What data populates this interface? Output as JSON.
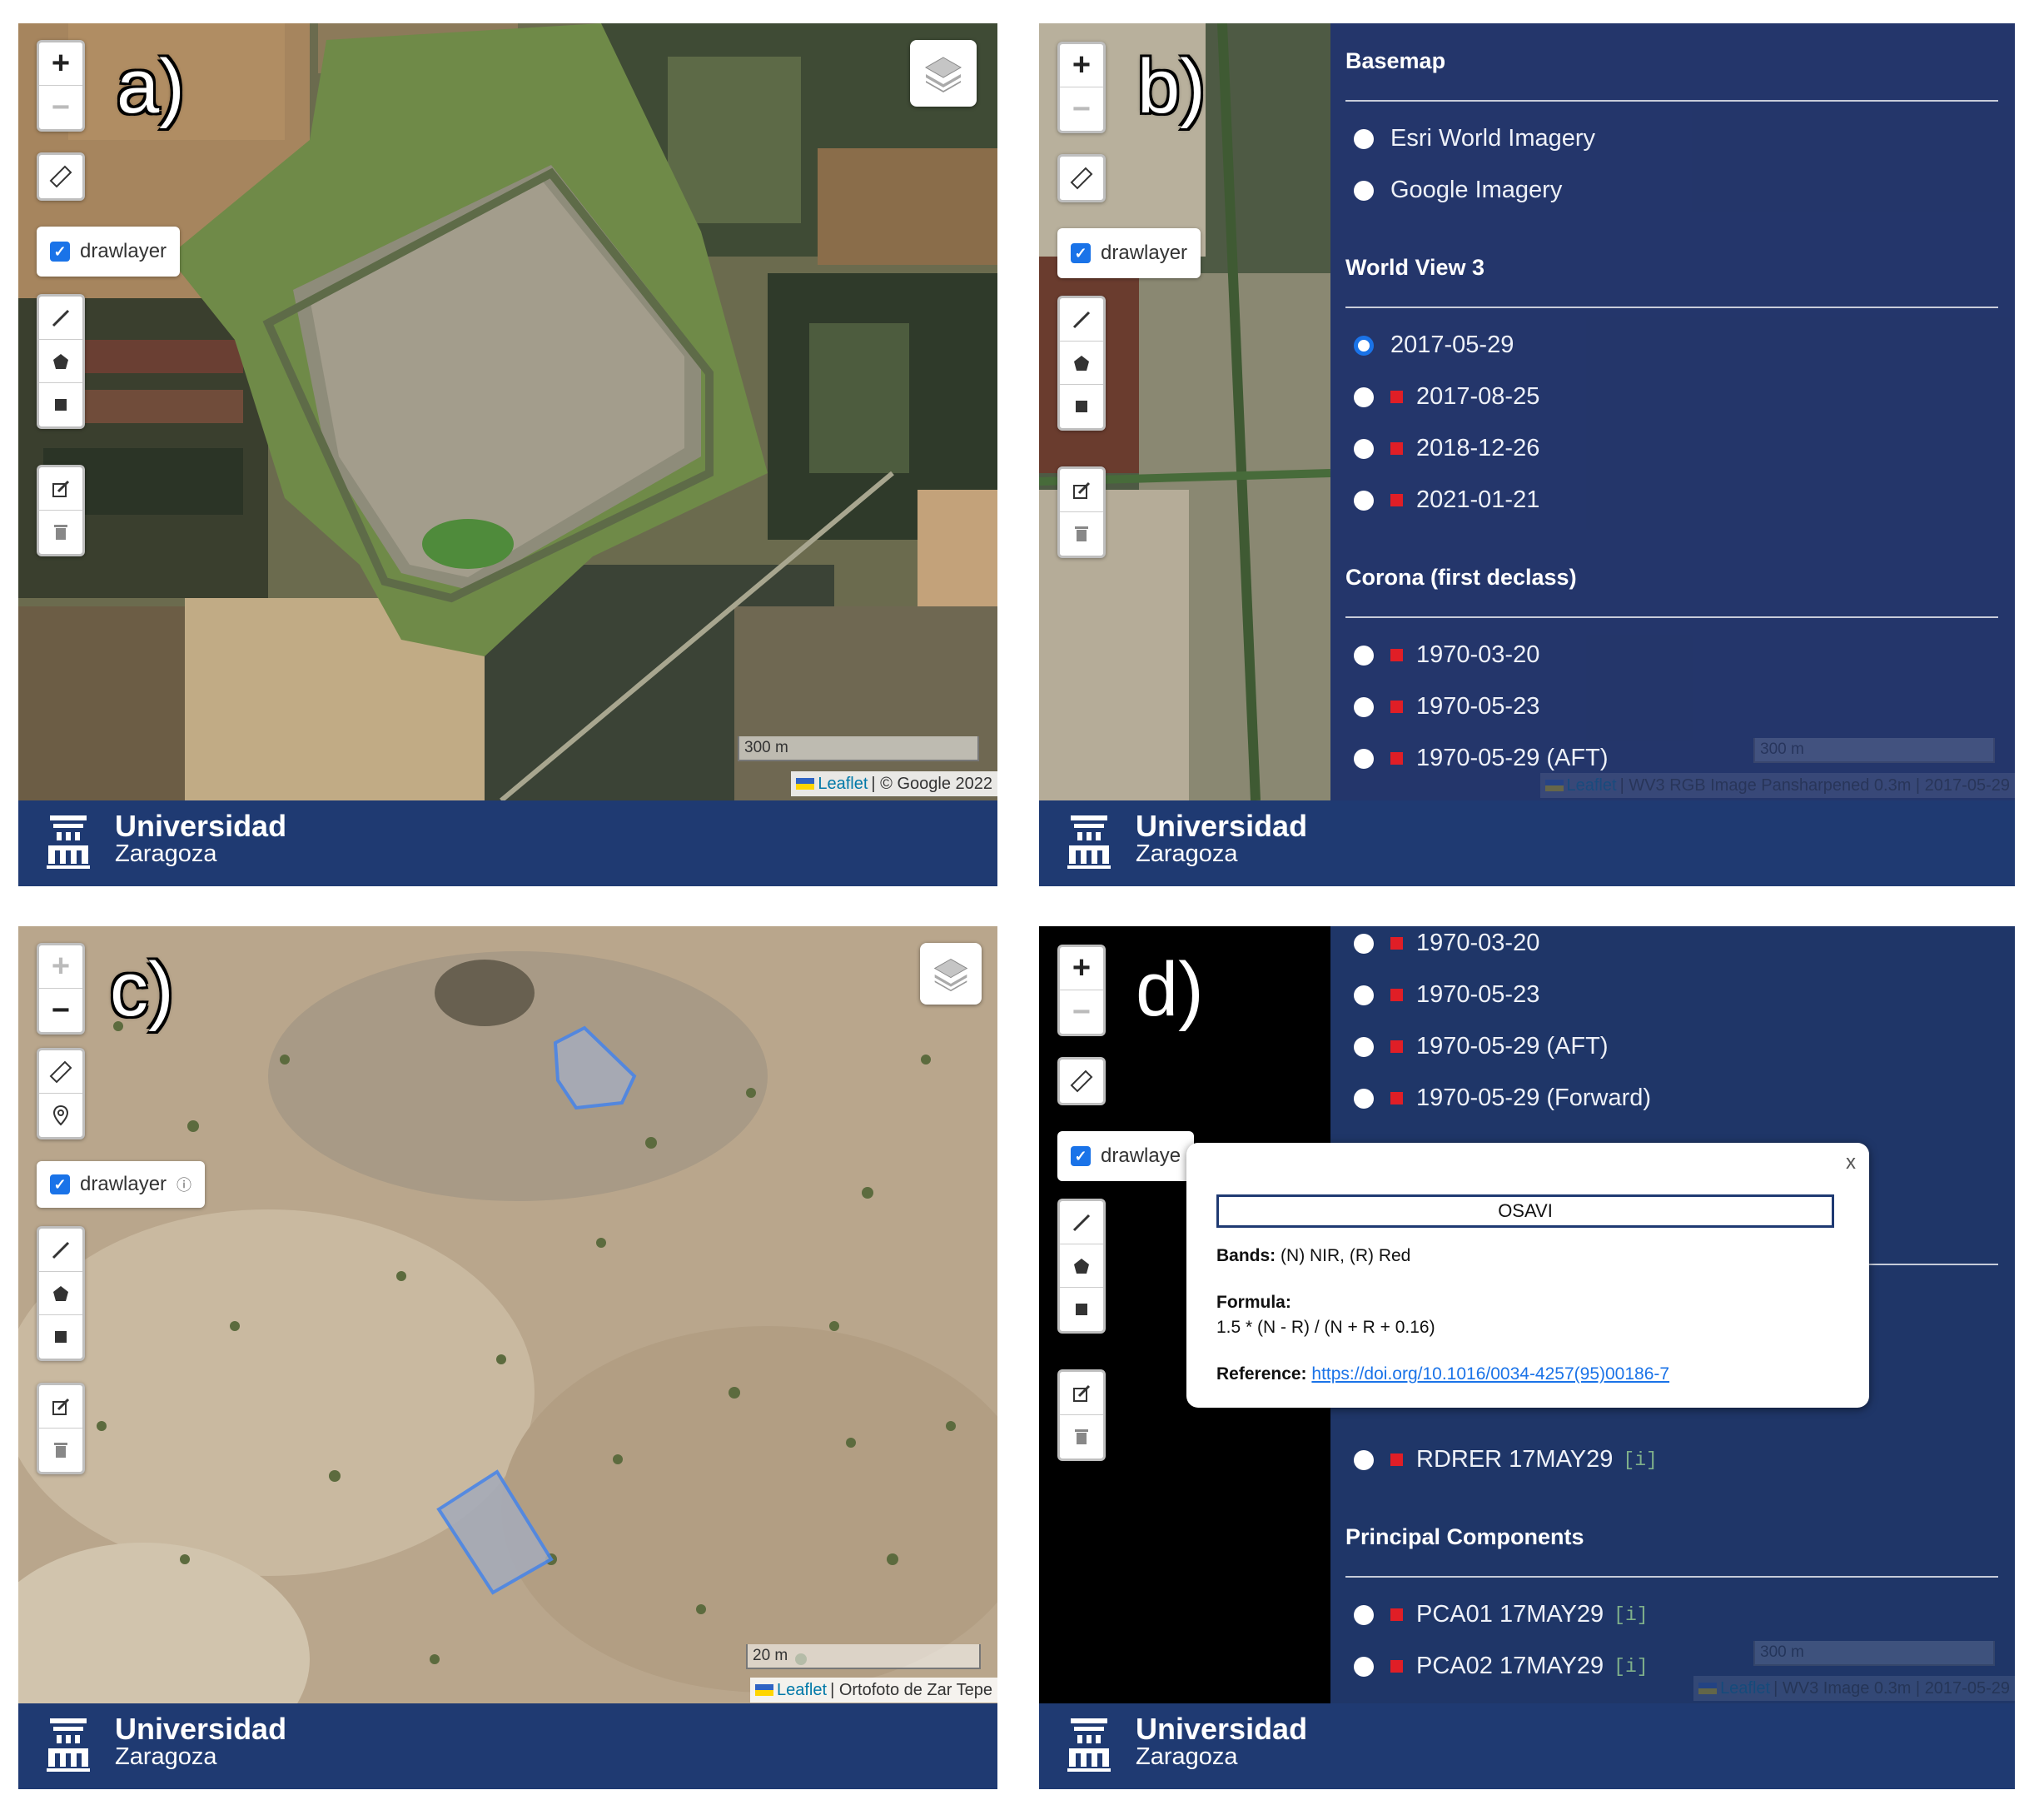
{
  "brand": {
    "name": "Universidad",
    "city": "Zaragoza"
  },
  "panels": [
    {
      "letter": "a)",
      "drawlayer": "drawlayer",
      "scale": "300 m",
      "attribution_leaflet": "Leaflet",
      "attribution_text": "| © Google 2022"
    },
    {
      "letter": "b)",
      "drawlayer": "drawlayer",
      "scale": "300 m",
      "attribution_leaflet": "Leaflet",
      "attribution_text": "| WV3 RGB Image Pansharpened 0.3m | 2017-05-29"
    },
    {
      "letter": "c)",
      "drawlayer": "drawlayer",
      "scale": "20 m",
      "attribution_leaflet": "Leaflet",
      "attribution_text": "| Ortofoto de Zar Tepe"
    },
    {
      "letter": "d)",
      "drawlayer": "drawlaye",
      "scale": "300 m",
      "attribution_leaflet": "Leaflet",
      "attribution_text": "| WV3 Image 0.3m | 2017-05-29"
    }
  ],
  "controls": {
    "zoom_in": "+",
    "zoom_out": "−"
  },
  "layers_b": {
    "basemap": {
      "heading": "Basemap",
      "items": [
        "Esri World Imagery",
        "Google Imagery"
      ]
    },
    "wv3": {
      "heading": "World View 3",
      "items": [
        "2017-05-29",
        "2017-08-25",
        "2018-12-26",
        "2021-01-21"
      ]
    },
    "corona": {
      "heading": "Corona (first declass)",
      "items": [
        "1970-03-20",
        "1970-05-23",
        "1970-05-29 (AFT)"
      ]
    }
  },
  "layers_d": {
    "items_top": [
      "1970-03-20",
      "1970-05-23",
      "1970-05-29 (AFT)",
      "1970-05-29 (Forward)"
    ],
    "rdrer": {
      "label": "RDRER 17MAY29",
      "info": "[i]"
    },
    "pc": {
      "heading": "Principal Components",
      "items": [
        {
          "label": "PCA01 17MAY29",
          "info": "[i]"
        },
        {
          "label": "PCA02 17MAY29",
          "info": "[i]"
        }
      ]
    }
  },
  "popup": {
    "close": "x",
    "title": "OSAVI",
    "bands_label": "Bands:",
    "bands_value": "(N) NIR, (R) Red",
    "formula_label": "Formula:",
    "formula_value": "1.5 * (N - R) / (N + R + 0.16)",
    "reference_label": "Reference:",
    "reference_value": "https://doi.org/10.1016/0034-4257(95)00186-7"
  },
  "colors": {
    "footer": "#1f3a72",
    "layer_panel": "#192d69",
    "marker": "#e01e26",
    "selected_radio": "#1a73e8"
  }
}
